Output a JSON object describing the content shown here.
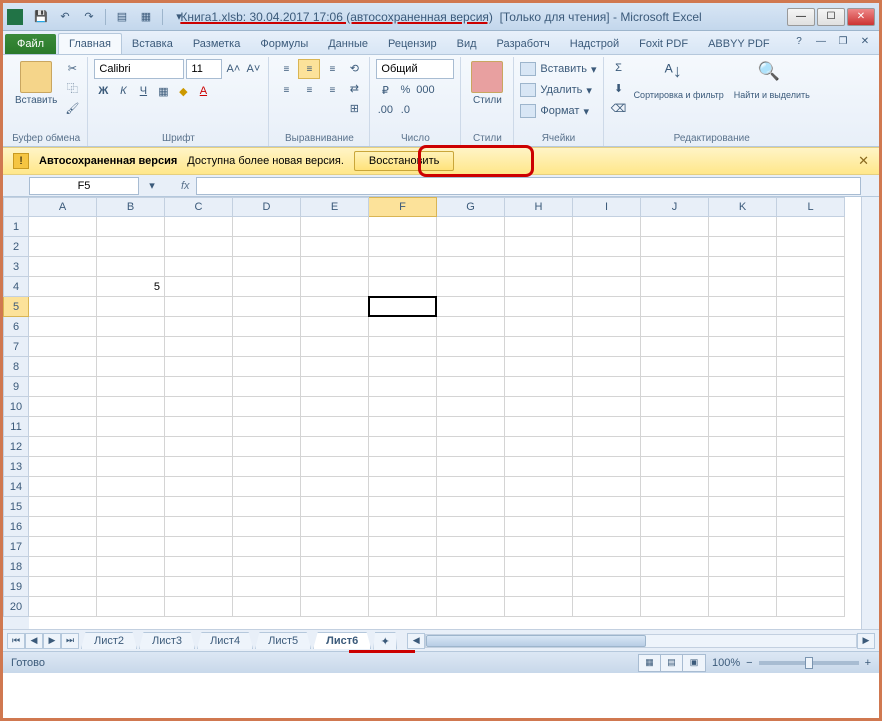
{
  "title": {
    "file": "Книга1.xlsb: 30.04.2017 17:06 (автосохраненная версия)",
    "mode": "[Только для чтения]",
    "app": "Microsoft Excel"
  },
  "tabs": {
    "file": "Файл",
    "items": [
      "Главная",
      "Вставка",
      "Разметка",
      "Формулы",
      "Данные",
      "Рецензир",
      "Вид",
      "Разработч",
      "Надстрой",
      "Foxit PDF",
      "ABBYY PDF"
    ],
    "active": 0
  },
  "ribbon": {
    "clipboard": {
      "paste": "Вставить",
      "label": "Буфер обмена"
    },
    "font": {
      "name": "Calibri",
      "size": "11",
      "label": "Шрифт"
    },
    "alignment": {
      "label": "Выравнивание"
    },
    "number": {
      "format": "Общий",
      "label": "Число"
    },
    "styles": {
      "btn": "Стили",
      "label": "Стили"
    },
    "cells": {
      "insert": "Вставить",
      "delete": "Удалить",
      "format": "Формат",
      "label": "Ячейки"
    },
    "editing": {
      "sort": "Сортировка и фильтр",
      "find": "Найти и выделить",
      "label": "Редактирование"
    }
  },
  "infobar": {
    "title": "Автосохраненная версия",
    "msg": "Доступна более новая версия.",
    "restore": "Восстановить"
  },
  "namebox": "F5",
  "columns": [
    "A",
    "B",
    "C",
    "D",
    "E",
    "F",
    "G",
    "H",
    "I",
    "J",
    "K",
    "L"
  ],
  "rows": 20,
  "cell_b4": "5",
  "selected": {
    "col": 5,
    "row": 4
  },
  "sheets": [
    "Лист2",
    "Лист3",
    "Лист4",
    "Лист5",
    "Лист6"
  ],
  "active_sheet": 4,
  "status": {
    "ready": "Готово",
    "zoom": "100%"
  }
}
